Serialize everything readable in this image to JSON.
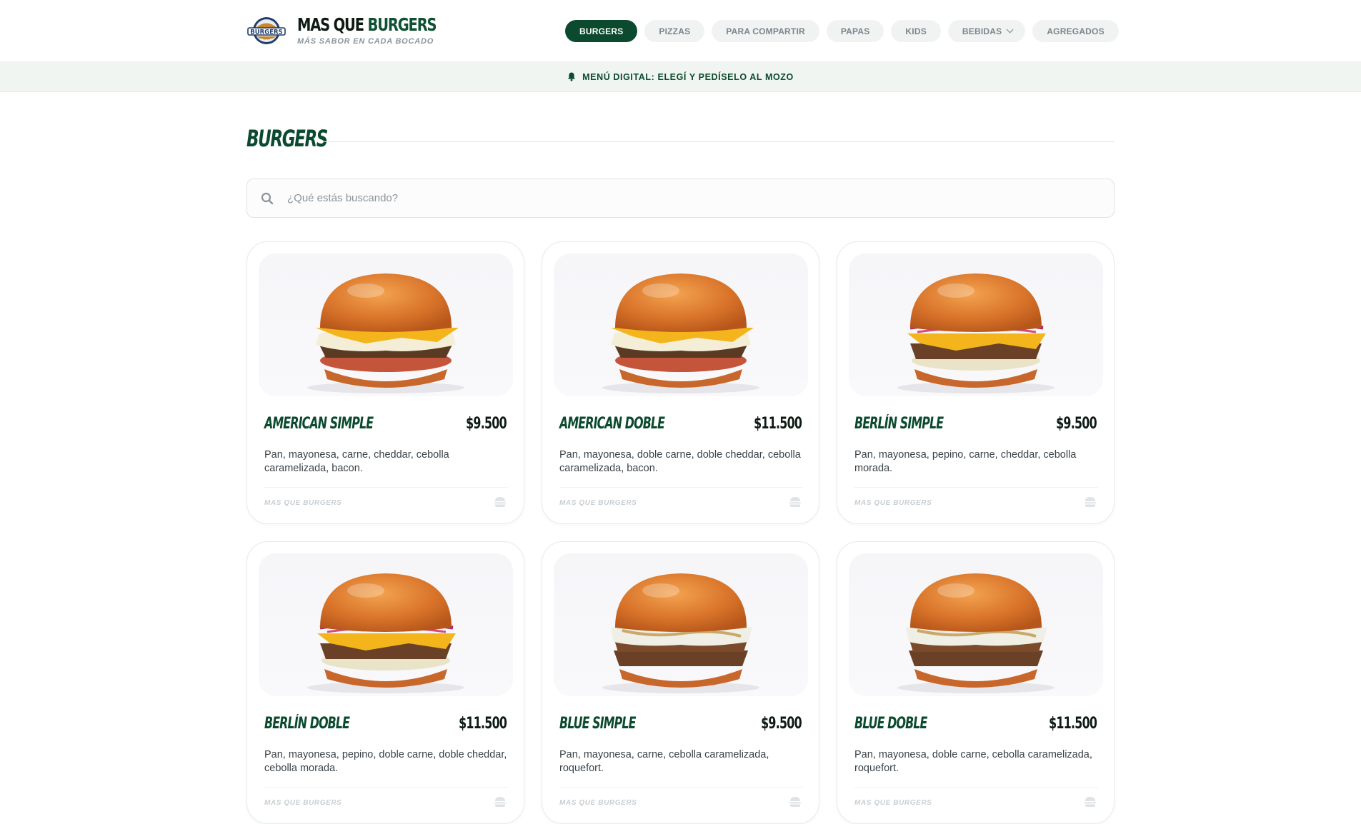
{
  "brand": {
    "logo_text": "BURGERS",
    "title_plain": "MAS QUE ",
    "title_accent": "BURGERS",
    "tagline": "MÁS SABOR EN CADA BOCADO"
  },
  "nav": {
    "items": [
      {
        "label": "BURGERS",
        "active": true
      },
      {
        "label": "PIZZAS",
        "active": false
      },
      {
        "label": "PARA COMPARTIR",
        "active": false
      },
      {
        "label": "PAPAS",
        "active": false
      },
      {
        "label": "KIDS",
        "active": false
      },
      {
        "label": "BEBIDAS",
        "active": false,
        "dropdown": true
      },
      {
        "label": "AGREGADOS",
        "active": false
      }
    ]
  },
  "banner": {
    "icon": "bell-icon",
    "text": "MENÚ DIGITAL: ELEGÍ Y PEDÍSELO AL MOZO"
  },
  "section": {
    "title": "BURGERS"
  },
  "search": {
    "placeholder": "¿Qué estás buscando?",
    "value": ""
  },
  "products": [
    {
      "name": "AMERICAN SIMPLE",
      "price": "$9.500",
      "description": "Pan, mayonesa, carne, cheddar, cebolla caramelizada, bacon.",
      "footer": "MAS QUE BURGERS",
      "style": "american"
    },
    {
      "name": "AMERICAN DOBLE",
      "price": "$11.500",
      "description": "Pan, mayonesa, doble carne, doble cheddar, cebolla caramelizada, bacon.",
      "footer": "MAS QUE BURGERS",
      "style": "american"
    },
    {
      "name": "BERLÍN SIMPLE",
      "price": "$9.500",
      "description": "Pan, mayonesa, pepino, carne, cheddar, cebolla morada.",
      "footer": "MAS QUE BURGERS",
      "style": "berlin"
    },
    {
      "name": "BERLÍN DOBLE",
      "price": "$11.500",
      "description": "Pan, mayonesa, pepino, doble carne, doble cheddar, cebolla morada.",
      "footer": "MAS QUE BURGERS",
      "style": "berlin"
    },
    {
      "name": "BLUE SIMPLE",
      "price": "$9.500",
      "description": "Pan, mayonesa, carne, cebolla caramelizada, roquefort.",
      "footer": "MAS QUE BURGERS",
      "style": "blue"
    },
    {
      "name": "BLUE DOBLE",
      "price": "$11.500",
      "description": "Pan, mayonesa, doble carne, cebolla caramelizada, roquefort.",
      "footer": "MAS QUE BURGERS",
      "style": "blue"
    }
  ],
  "colors": {
    "primary": "#0b4a2e",
    "banner_bg": "#f1f5f2",
    "pill_bg": "#f1f3f2",
    "muted_text": "#7b858d"
  }
}
